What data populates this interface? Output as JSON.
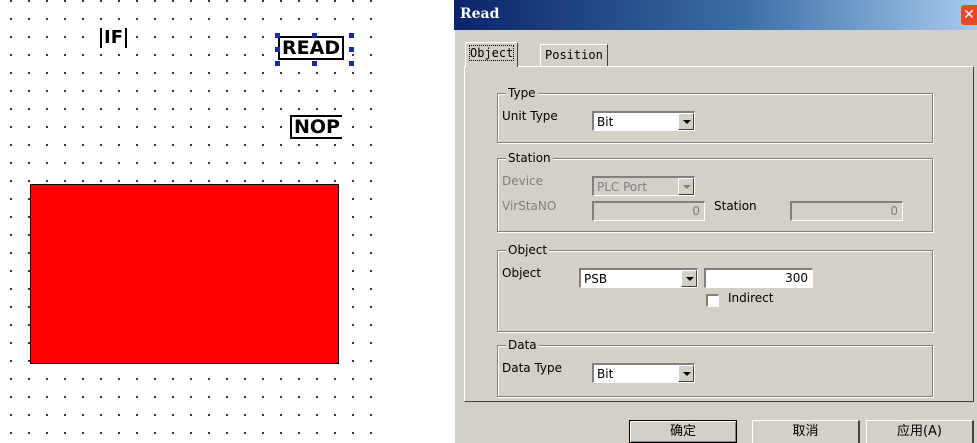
{
  "canvas": {
    "components": {
      "if_label": "IF",
      "read_label": "READ",
      "nop_label": "NOP"
    },
    "red_rect_color": "#ff0000"
  },
  "dialog": {
    "title": "Read",
    "close_glyph": "✕",
    "tabs": [
      {
        "label": "Object",
        "active": true
      },
      {
        "label": "Position",
        "active": false
      }
    ],
    "groups": {
      "type": {
        "legend": "Type",
        "unit_type_label": "Unit Type",
        "unit_type_value": "Bit"
      },
      "station": {
        "legend": "Station",
        "device_label": "Device",
        "device_value": "PLC Port",
        "virstano_label": "VirStaNO",
        "virstano_value": "0",
        "station_label": "Station",
        "station_value": "0"
      },
      "object": {
        "legend": "Object",
        "object_label": "Object",
        "object_type_value": "PSB",
        "object_address_value": "300",
        "indirect_label": "Indirect",
        "indirect_checked": false
      },
      "data": {
        "legend": "Data",
        "data_type_label": "Data Type",
        "data_type_value": "Bit"
      }
    },
    "buttons": {
      "ok": "确定",
      "cancel": "取消",
      "apply": "应用(A)"
    }
  },
  "colors": {
    "title_bar_start": "#0a246a",
    "title_bar_end": "#a6caf0",
    "dialog_face": "#d4d0c8",
    "selection_handle": "#1a2b9c"
  }
}
